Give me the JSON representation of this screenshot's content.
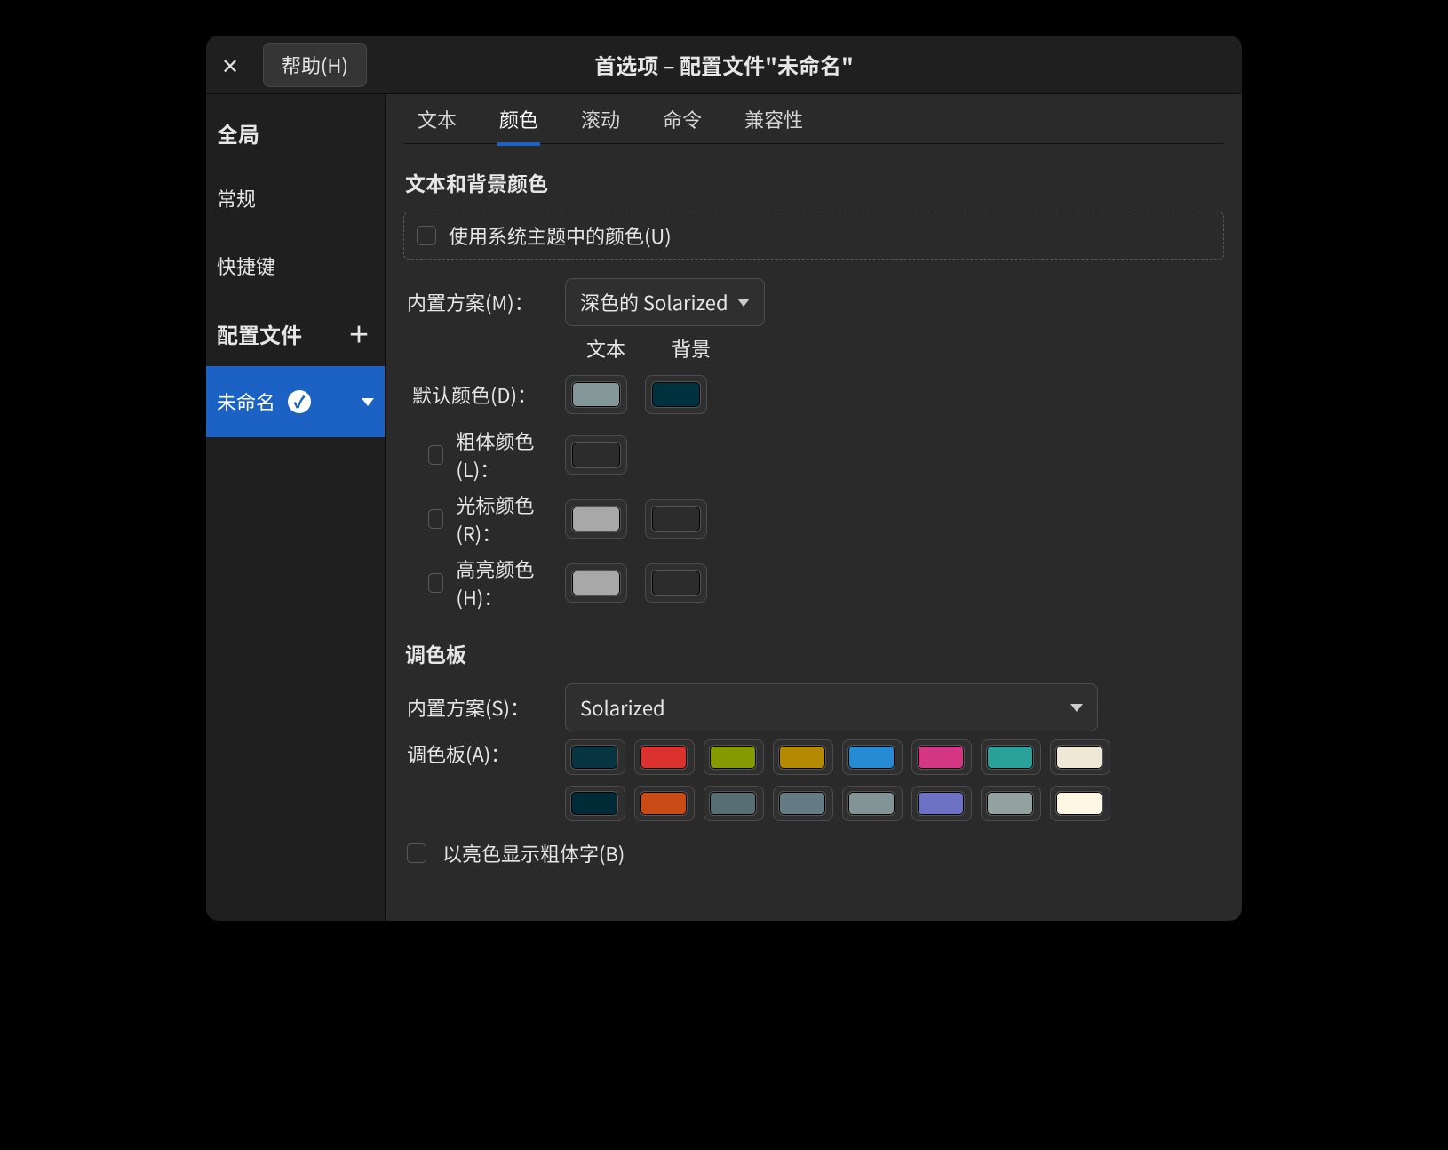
{
  "titlebar": {
    "close_icon": "✕",
    "help_label": "帮助(H)",
    "title": "首选项 – 配置文件\"未命名\""
  },
  "sidebar": {
    "global_header": "全局",
    "items": {
      "general": "常规",
      "shortcuts": "快捷键"
    },
    "profiles_header": "配置文件",
    "active_profile": "未命名"
  },
  "tabs": {
    "text": "文本",
    "color": "颜色",
    "scroll": "滚动",
    "command": "命令",
    "compat": "兼容性"
  },
  "sections": {
    "text_bg_title": "文本和背景颜色",
    "use_system_theme": "使用系统主题中的颜色(U)",
    "builtin_scheme_label": "内置方案(M)：",
    "builtin_scheme_value": "深色的 Solarized",
    "col_text": "文本",
    "col_bg": "背景",
    "default_color_label": "默认颜色(D)：",
    "bold_color_label": "粗体颜色(L)：",
    "cursor_color_label": "光标颜色(R)：",
    "highlight_color_label": "高亮颜色(H)：",
    "palette_title": "调色板",
    "palette_scheme_label": "内置方案(S)：",
    "palette_scheme_value": "Solarized",
    "palette_swatches_label": "调色板(A)：",
    "bold_bright_label": "以亮色显示粗体字(B)"
  },
  "colors": {
    "default_text": "#84989a",
    "default_bg": "#00313f",
    "bold_text": "#2c2c2c",
    "cursor_text": "#a8a8a8",
    "cursor_bg": "#2c2c2c",
    "highlight_text": "#a8a8a8",
    "highlight_bg": "#2c2c2c",
    "palette": [
      "#073642",
      "#dc322f",
      "#859900",
      "#b58900",
      "#268bd2",
      "#d33682",
      "#2aa198",
      "#eee8d5",
      "#002b36",
      "#cb4b16",
      "#586e75",
      "#657b83",
      "#839496",
      "#6c71c4",
      "#93a1a1",
      "#fdf6e3"
    ]
  }
}
